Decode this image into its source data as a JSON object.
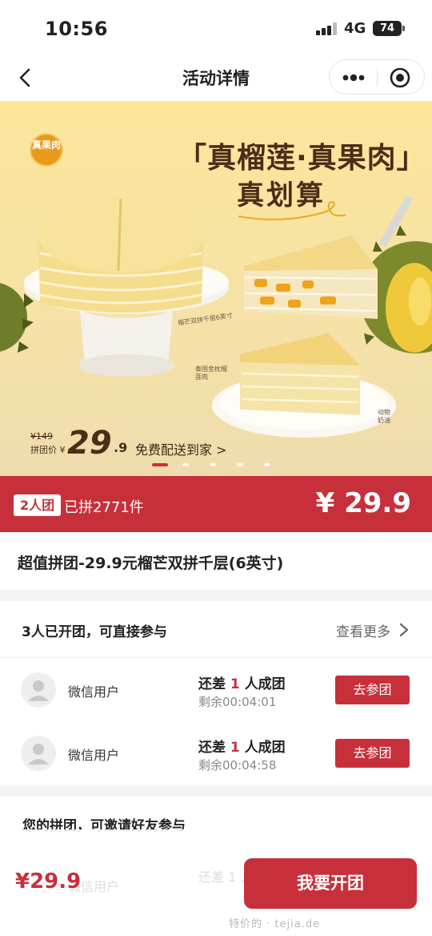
{
  "status_bar": {
    "time": "10:56",
    "network": "4G",
    "battery": "74"
  },
  "nav": {
    "title": "活动详情"
  },
  "banner": {
    "seal_text": "真果肉",
    "slogan_line1": "「真榴莲·真果肉」",
    "slogan_line2": "真划算",
    "caption_1": "榴芒双拼千层6英寸",
    "caption_2": "泰国金枕榴莲肉",
    "caption_3": "动物奶油",
    "original_price": "¥149",
    "group_price_label": "拼团价 ¥",
    "price_int": "29",
    "price_frac": ".9",
    "free_delivery": "免费配送到家 >",
    "slide_count": 5,
    "active_slide": 0
  },
  "price_bar": {
    "team_size": "2人团",
    "sold": "已拼2771件",
    "price": "¥ 29.9"
  },
  "product": {
    "title": "超值拼团-29.9元榴芒双拼千层(6英寸)"
  },
  "groups": {
    "header": "3人已开团，可直接参与",
    "see_more": "查看更多",
    "rows": [
      {
        "user": "微信用户",
        "need_prefix": "还差",
        "need_count": "1",
        "need_suffix": "人成团",
        "remaining": "剩余00:04:01",
        "button": "去参团"
      },
      {
        "user": "微信用户",
        "need_prefix": "还差",
        "need_count": "1",
        "need_suffix": "人成团",
        "remaining": "剩余00:04:58",
        "button": "去参团"
      }
    ]
  },
  "my_group": {
    "header": "您的拼团，可邀请好友参与",
    "ghost_user": "微信用户",
    "ghost_need": "还差 1 人成团"
  },
  "bottom_bar": {
    "price": "¥29.9",
    "button": "我要开团"
  },
  "watermark": "特价的 · tejia.de",
  "colors": {
    "accent": "#c7303a",
    "banner_bg": "#fbe69a",
    "text_brown": "#4b2d18"
  }
}
